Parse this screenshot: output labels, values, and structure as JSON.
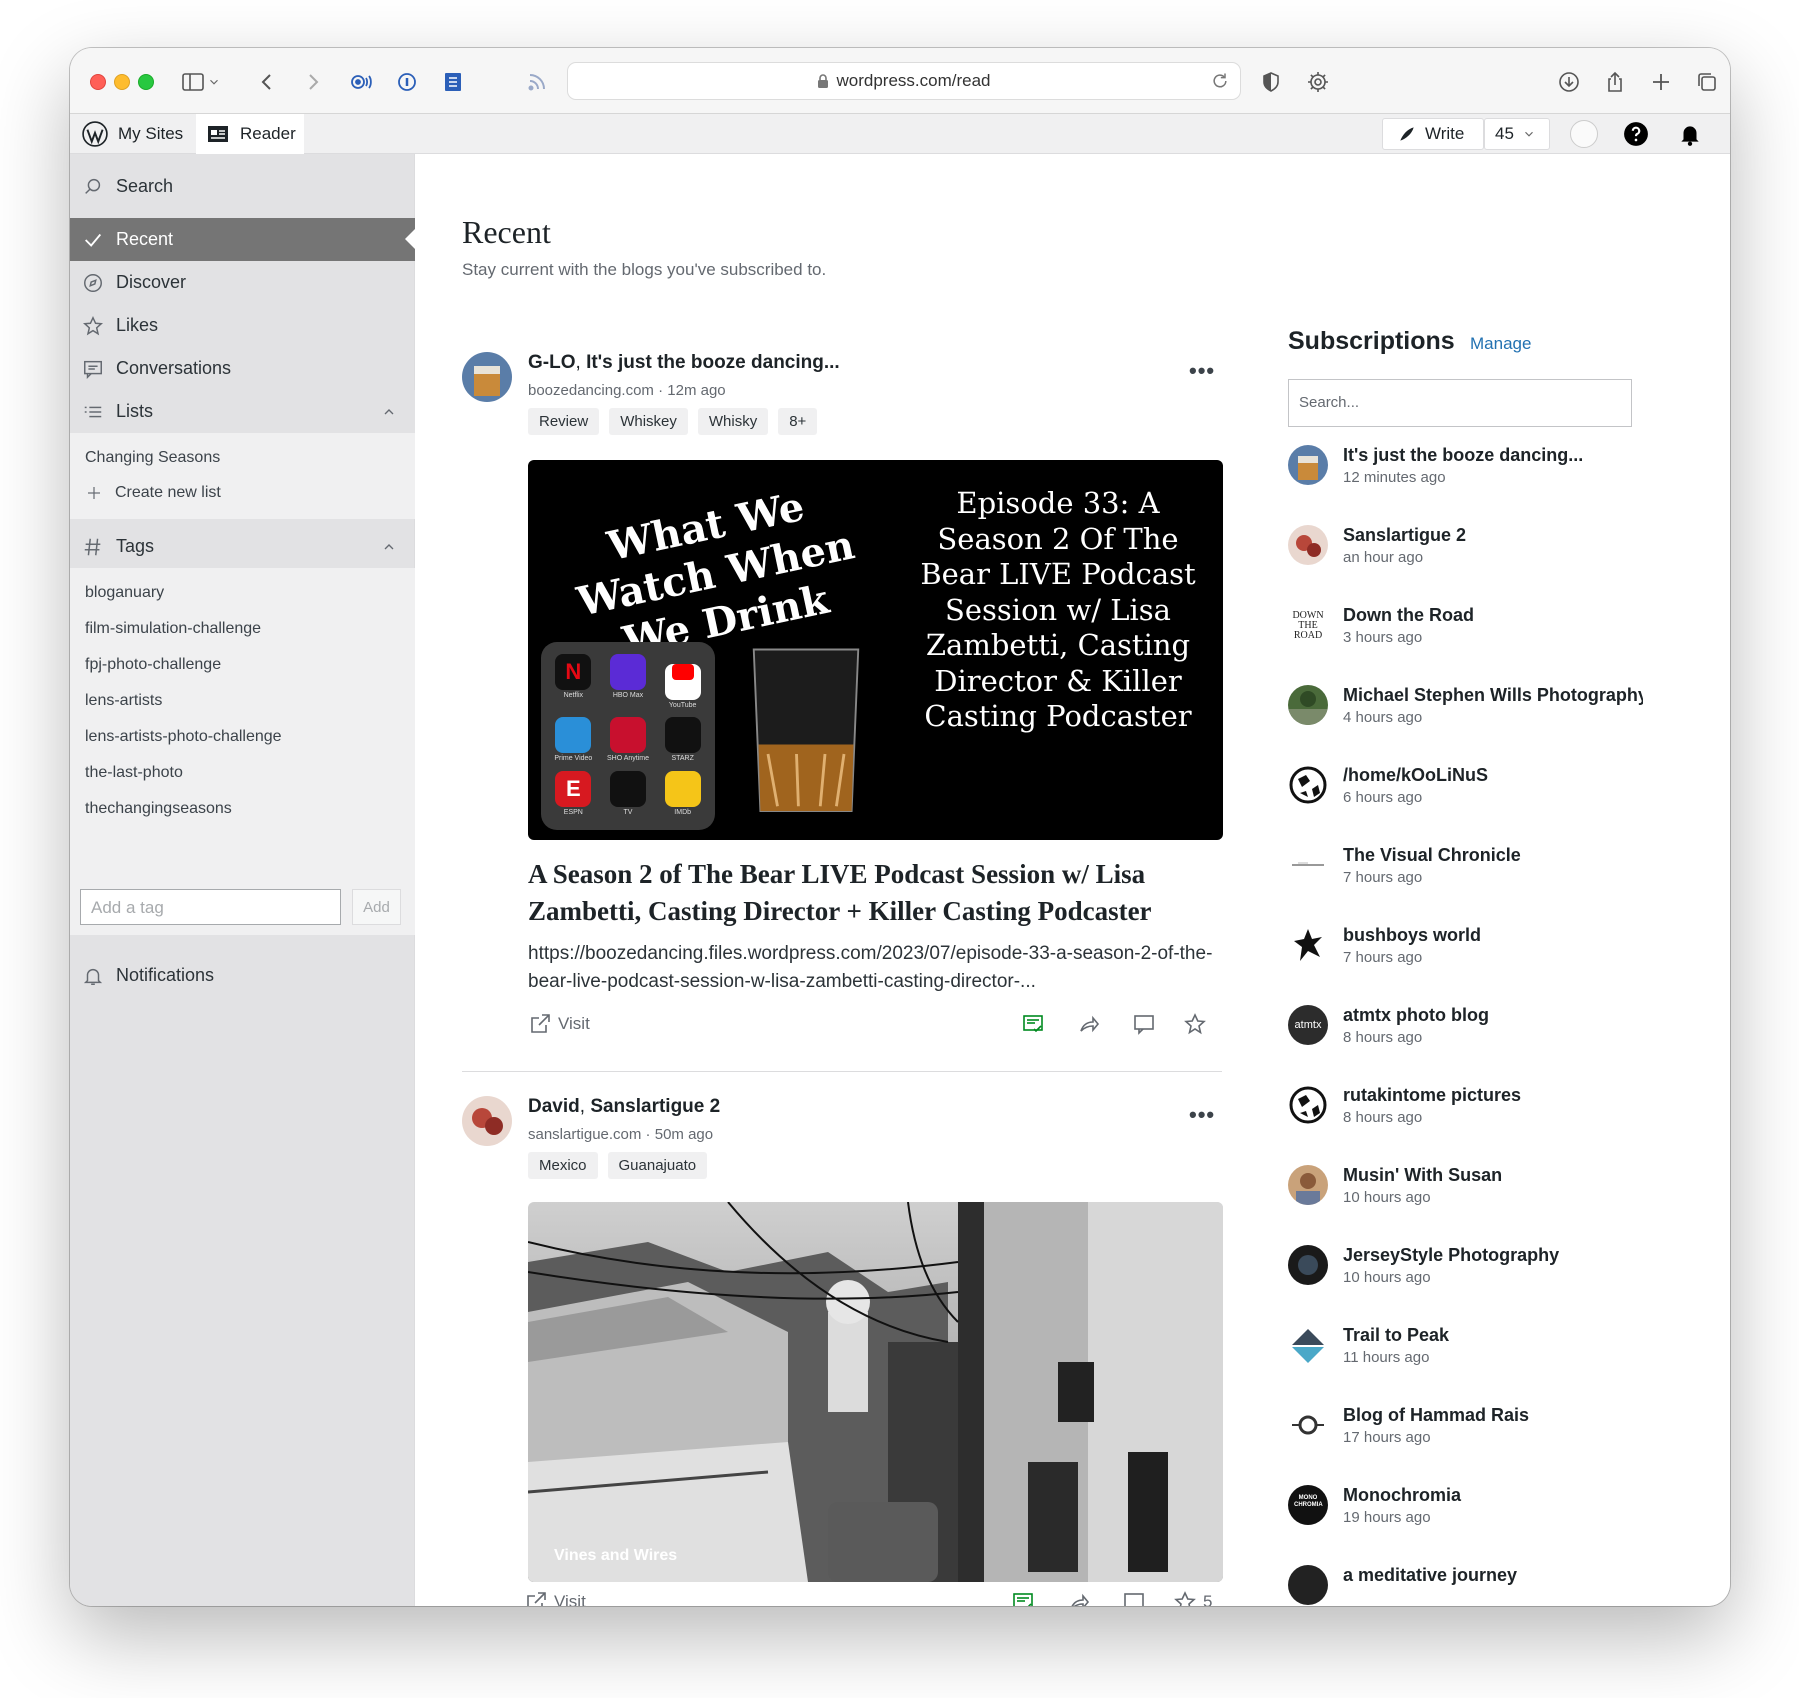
{
  "browser": {
    "url": "wordpress.com/read"
  },
  "adminbar": {
    "my_sites": "My Sites",
    "reader": "Reader",
    "write": "Write",
    "count": "45"
  },
  "sidebar": {
    "search": "Search",
    "recent": "Recent",
    "discover": "Discover",
    "likes": "Likes",
    "conversations": "Conversations",
    "lists": "Lists",
    "list_items": [
      "Changing Seasons"
    ],
    "create_list": "Create new list",
    "tags": "Tags",
    "tag_items": [
      "bloganuary",
      "film-simulation-challenge",
      "fpj-photo-challenge",
      "lens-artists",
      "lens-artists-photo-challenge",
      "the-last-photo",
      "thechangingseasons"
    ],
    "tag_placeholder": "Add a tag",
    "tag_add": "Add",
    "notifications": "Notifications"
  },
  "main": {
    "title": "Recent",
    "subtitle": "Stay current with the blogs you've subscribed to."
  },
  "posts": [
    {
      "author": "G-LO",
      "blog": "It's just the booze dancing...",
      "domain": "boozedancing.com",
      "time": "12m ago",
      "tags": [
        "Review",
        "Whiskey",
        "Whisky",
        "8+"
      ],
      "image_left_text": "What We Watch When We Drink",
      "image_right_text": "Episode 33: A Season 2 Of The Bear LIVE Podcast Session w/ Lisa Zambetti, Casting Director & Killer Casting Podcaster",
      "apps": [
        "Netflix",
        "HBO Max",
        "YouTube",
        "Prime Video",
        "SHO Anytime",
        "STARZ",
        "ESPN",
        "TV",
        "IMDb"
      ],
      "title": "A Season 2 of The Bear LIVE Podcast Session w/ Lisa Zambetti, Casting Director + Killer Casting Podcaster",
      "excerpt": "https://boozedancing.files.wordpress.com/2023/07/episode-33-a-season-2-of-the-bear-live-podcast-session-w-lisa-zambetti-casting-director-...",
      "visit": "Visit"
    },
    {
      "author": "David",
      "blog": "Sanslartigue 2",
      "domain": "sanslartigue.com",
      "time": "50m ago",
      "tags": [
        "Mexico",
        "Guanajuato"
      ],
      "image_caption": "Vines and Wires",
      "visit": "Visit",
      "likes": "5"
    }
  ],
  "subscriptions": {
    "title": "Subscriptions",
    "manage": "Manage",
    "search_placeholder": "Search...",
    "items": [
      {
        "name": "It's just the booze dancing...",
        "time": "12 minutes ago"
      },
      {
        "name": "Sanslartigue 2",
        "time": "an hour ago"
      },
      {
        "name": "Down the Road",
        "time": "3 hours ago"
      },
      {
        "name": "Michael Stephen Wills Photography",
        "time": "4 hours ago"
      },
      {
        "name": "/home/kOoLiNuS",
        "time": "6 hours ago"
      },
      {
        "name": "The Visual Chronicle",
        "time": "7 hours ago"
      },
      {
        "name": "bushboys world",
        "time": "7 hours ago"
      },
      {
        "name": "atmtx photo blog",
        "time": "8 hours ago"
      },
      {
        "name": "rutakintome pictures",
        "time": "8 hours ago"
      },
      {
        "name": "Musin' With Susan",
        "time": "10 hours ago"
      },
      {
        "name": "JerseyStyle Photography",
        "time": "10 hours ago"
      },
      {
        "name": "Trail to Peak",
        "time": "11 hours ago"
      },
      {
        "name": "Blog of Hammad Rais",
        "time": "17 hours ago"
      },
      {
        "name": "Monochromia",
        "time": "19 hours ago"
      },
      {
        "name": "a meditative journey",
        "time": ""
      }
    ]
  },
  "avatars": {
    "down_the_road": "DOWN THE ROAD",
    "atmtx": "atmtx",
    "monochromia": "MONO CHROMIA"
  },
  "colors": {
    "accent": "#2271b1",
    "sidebar_active": "#757575",
    "sidebar_bg": "#e2e2e4"
  }
}
